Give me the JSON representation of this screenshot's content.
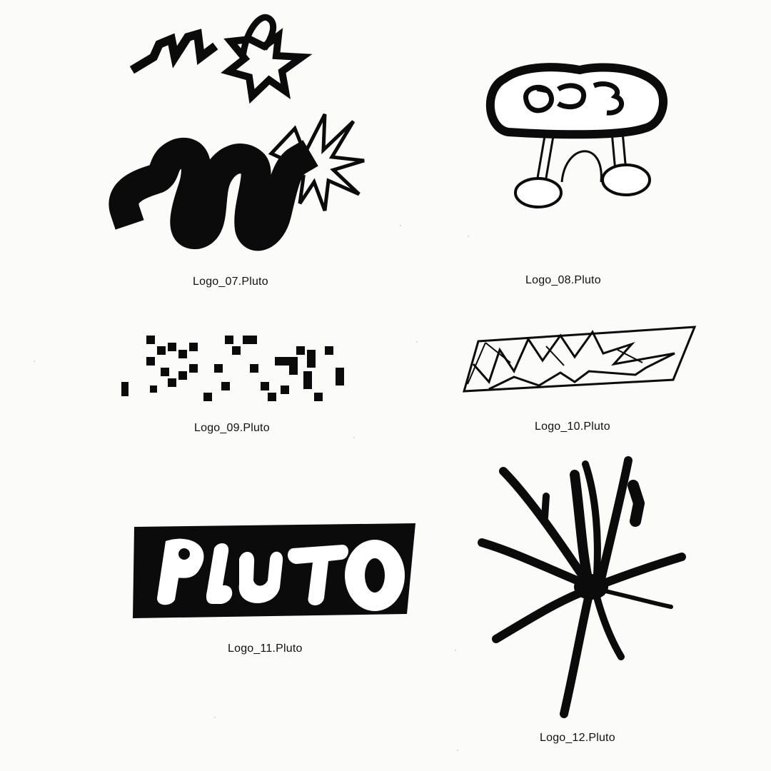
{
  "sheet": {
    "paper_color": "#fbfbfa",
    "ink_color": "#0b0b0b"
  },
  "logos": [
    {
      "id": "07",
      "caption": "Logo_07.Pluto",
      "icon": "squiggle-with-starburst-icon"
    },
    {
      "id": "08",
      "caption": "Logo_08.Pluto",
      "icon": "cloud-with-bubble-letters-and-legs-icon"
    },
    {
      "id": "09",
      "caption": "Logo_09.Pluto",
      "icon": "pixel-block-lettering-icon"
    },
    {
      "id": "10",
      "caption": "Logo_10.Pluto",
      "icon": "slanted-lightning-panel-icon"
    },
    {
      "id": "11",
      "caption": "Logo_11.Pluto",
      "icon": "pluto-bubble-wordmark-icon",
      "wordmark": "PLUTO"
    },
    {
      "id": "12",
      "caption": "Logo_12.Pluto",
      "icon": "brush-splat-starburst-icon"
    }
  ]
}
